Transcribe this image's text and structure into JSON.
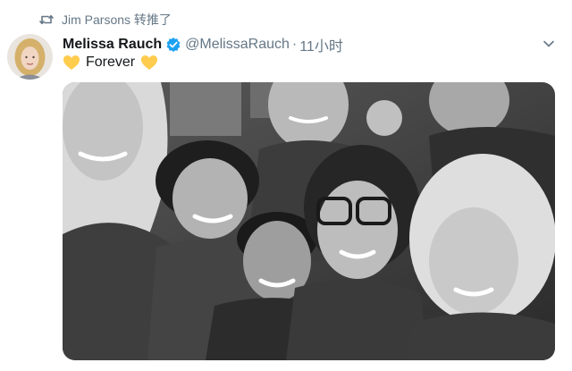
{
  "retweet": {
    "icon": "retweet-icon",
    "text": "Jim Parsons 转推了"
  },
  "author": {
    "avatar_icon": "avatar-photo",
    "display_name": "Melissa Rauch",
    "verified_icon": "verified-badge-icon",
    "handle": "@MelissaRauch",
    "separator": "·",
    "time": "11小时"
  },
  "menu": {
    "icon": "chevron-down-icon"
  },
  "tweet": {
    "text": "Forever",
    "emoji_icon": "yellow-heart-icon"
  },
  "media": {
    "type": "black-and-white group selfie photo"
  },
  "colors": {
    "accent": "#1da1f2",
    "secondary_text": "#657786",
    "primary_text": "#14171a",
    "heart": "#ffcc4d"
  }
}
